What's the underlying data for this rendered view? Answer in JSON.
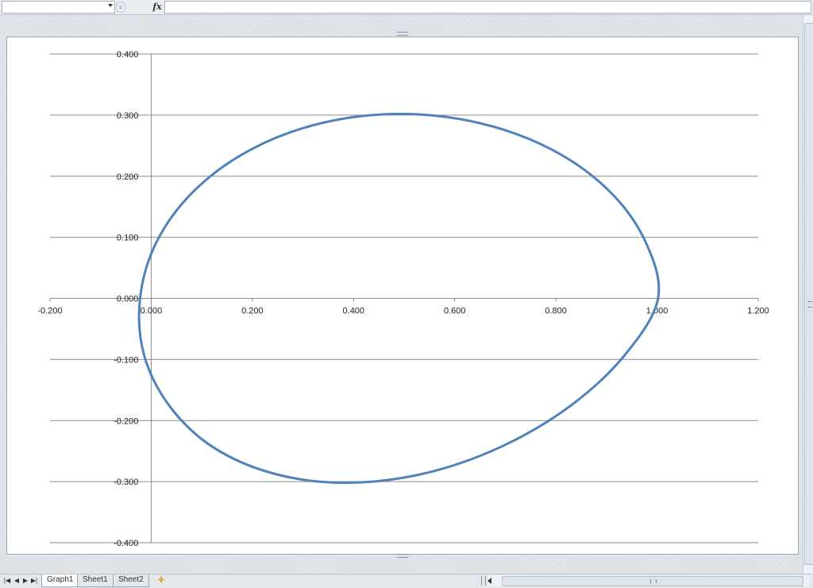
{
  "formula_bar": {
    "name_box_value": "",
    "fx_label": "fx",
    "formula_value": ""
  },
  "sheet_tabs": [
    {
      "label": "Graph1",
      "active": true
    },
    {
      "label": "Sheet1",
      "active": false
    },
    {
      "label": "Sheet2",
      "active": false
    }
  ],
  "colors": {
    "series_line": "#4f81bd",
    "gridline": "#8c8c8c",
    "axis": "#8c8c8c"
  },
  "chart_data": {
    "type": "scatter",
    "title": "",
    "xlabel": "",
    "ylabel": "",
    "xlim": [
      -0.2,
      1.2
    ],
    "ylim": [
      -0.4,
      0.4
    ],
    "x_ticks": [
      "-0.200",
      "0.000",
      "0.200",
      "0.400",
      "0.600",
      "0.800",
      "1.000",
      "1.200"
    ],
    "y_ticks": [
      "0.400",
      "0.300",
      "0.200",
      "0.100",
      "0.000",
      "-0.100",
      "-0.200",
      "-0.300",
      "-0.400"
    ],
    "grid": "horizontal major",
    "legend": "none",
    "series": [
      {
        "style": "smooth line, no markers",
        "x": [
          1.002,
          0.977,
          0.904,
          0.791,
          0.649,
          0.492,
          0.337,
          0.198,
          0.086,
          0.011,
          -0.022,
          -0.014,
          0.037,
          0.123,
          0.243,
          0.384,
          0.538,
          0.689,
          0.827,
          0.936,
          1.002
        ],
        "y": [
          0.0,
          0.093,
          0.177,
          0.244,
          0.287,
          0.302,
          0.287,
          0.244,
          0.177,
          0.093,
          0.0,
          -0.093,
          -0.177,
          -0.244,
          -0.287,
          -0.302,
          -0.287,
          -0.244,
          -0.177,
          -0.093,
          0.0
        ]
      }
    ]
  }
}
